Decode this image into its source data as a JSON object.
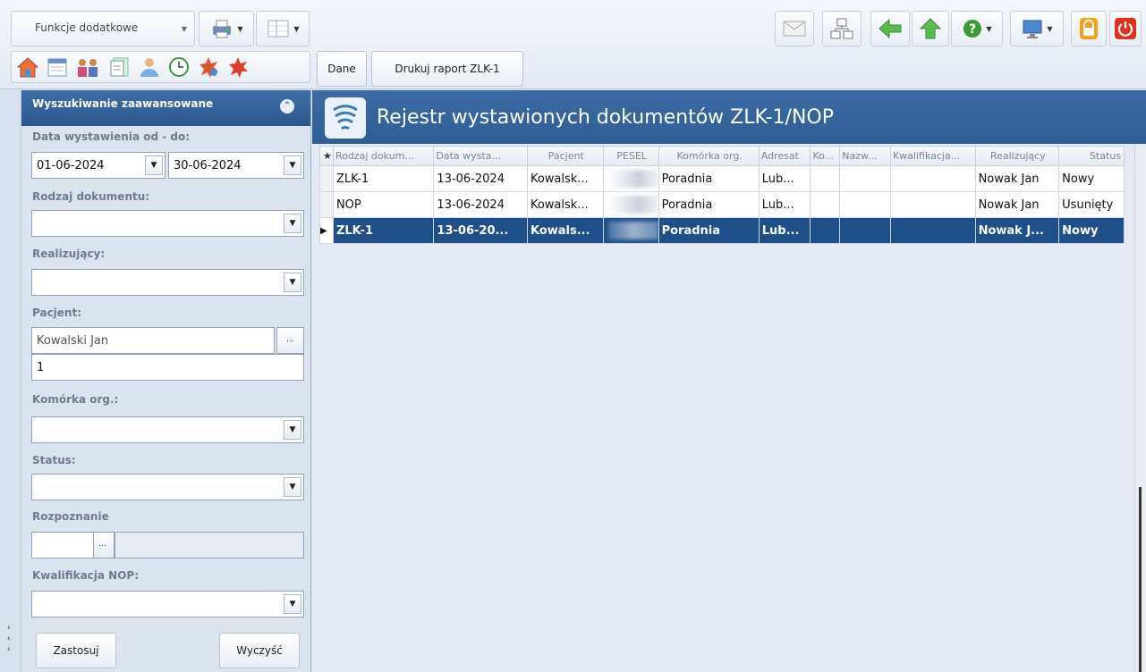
{
  "toolbar": {
    "extra_functions_label": "Funkcje dodatkowe",
    "dane_label": "Dane",
    "print_report_label": "Drukuj raport ZLK-1"
  },
  "filters": {
    "panel_title": "Wyszukiwanie zaawansowane",
    "date_label": "Data wystawienia od - do:",
    "date_from": "01-06-2024",
    "date_to": "30-06-2024",
    "doc_type_label": "Rodzaj dokumentu:",
    "doc_type_value": "",
    "performer_label": "Realizujący:",
    "performer_value": "",
    "patient_label": "Pacjent:",
    "patient_value": "Kowalski Jan",
    "patient_second_value": "1",
    "org_unit_label": "Komórka org.:",
    "org_unit_value": "",
    "status_label": "Status:",
    "status_value": "",
    "diagnosis_label": "Rozpoznanie",
    "diagnosis_value": "",
    "nop_label": "Kwalifikacja NOP:",
    "nop_value": "",
    "ellipsis": "...",
    "apply_label": "Zastosuj",
    "clear_label": "Wyczyść"
  },
  "main": {
    "title": "Rejestr wystawionych dokumentów ZLK-1/NOP",
    "columns": [
      "Rodzaj dokum...",
      "Data wysta...",
      "Pacjent",
      "PESEL",
      "Komórka org.",
      "Adresat",
      "Ko...",
      "Nazw...",
      "Kwalifikacja...",
      "Realizujący",
      "Status"
    ],
    "rows": [
      {
        "type": "ZLK-1",
        "date": "13-06-2024",
        "patient": "Kowalsk...",
        "unit": "Poradnia",
        "addressee": "Lub...",
        "performer": "Nowak Jan",
        "status": "Nowy"
      },
      {
        "type": "NOP",
        "date": "13-06-2024",
        "patient": "Kowalsk...",
        "unit": "Poradnia",
        "addressee": "Lub...",
        "performer": "Nowak Jan",
        "status": "Usunięty"
      },
      {
        "type": "ZLK-1",
        "date": "13-06-20...",
        "patient": "Kowals...",
        "unit": "Poradnia",
        "addressee": "Lub...",
        "performer": "Nowak J...",
        "status": "Nowy"
      }
    ]
  },
  "icons": {
    "top_right": [
      "mail-icon",
      "network-icon",
      "back-arrow-icon",
      "up-arrow-icon",
      "help-icon",
      "monitor-icon",
      "lock-icon",
      "power-icon"
    ],
    "nav": [
      "home-icon",
      "calendar-icon",
      "people-icon",
      "documents-icon",
      "patient-icon",
      "clock-icon",
      "vaccine-icon",
      "red-cross-icon"
    ]
  },
  "colors": {
    "header_blue": "#2f5d96",
    "selected_row": "#1f4f8a"
  }
}
